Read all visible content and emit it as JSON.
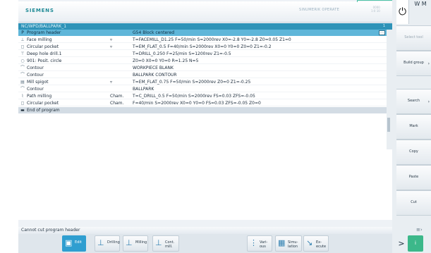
{
  "header": {
    "brand": "SIEMENS",
    "title_right": "SINUMERIK OPERATE",
    "mini_text": [
      "0000",
      "1:0 10"
    ]
  },
  "path_bar": {
    "path": "NC/WPD/BALLPARK_1",
    "number": "1"
  },
  "program": {
    "rows": [
      {
        "icon": "program-header-icon",
        "glyph": "P",
        "name": "Program header",
        "mode": "",
        "params": "G54 Block centered",
        "state": "selected"
      },
      {
        "icon": "face-milling-icon",
        "glyph": "⊥",
        "name": "Face milling",
        "mode": "▿",
        "params": "T=FACEMILL_D1.25 F=50/min S=2000rev X0=-2.8 Y0=-2.8 Z0=0.05 Z1=0",
        "state": ""
      },
      {
        "icon": "circular-pocket-icon",
        "glyph": "◻",
        "name": "Circular pocket",
        "mode": "▿",
        "params": "T=EM_FLAT_0.5 F=40/min S=2000rev X0=0 Y0=0 Z0=0 Z1=-0.2",
        "state": ""
      },
      {
        "icon": "deep-hole-drill-icon",
        "glyph": "⊤",
        "name": "Deep hole drill.1",
        "mode": "",
        "params": "T=DRILL_0.250 F=25/min S=1200rev Z1=-0.5",
        "state": ""
      },
      {
        "icon": "posit-circle-icon",
        "glyph": "○",
        "name": "901: Posit. circle",
        "mode": "",
        "params": "Z0=0 X0=0 Y0=0 R=1.25 N=5",
        "state": ""
      },
      {
        "icon": "contour-icon",
        "glyph": "⌒",
        "name": "Contour",
        "mode": "",
        "params": "WORKPIECE BLANK",
        "state": ""
      },
      {
        "icon": "contour-icon",
        "glyph": "⌒",
        "name": "Contour",
        "mode": "",
        "params": "BALLPARK CONTOUR",
        "state": ""
      },
      {
        "icon": "mill-spigot-icon",
        "glyph": "▤",
        "name": "Mill spigot",
        "mode": "▿",
        "params": "T=EM_FLAT_0.75 F=50/min S=2000rev Z0=0 Z1=-0.25",
        "state": ""
      },
      {
        "icon": "contour-icon",
        "glyph": "⌒",
        "name": "Contour",
        "mode": "",
        "params": "BALLPARK",
        "state": ""
      },
      {
        "icon": "path-milling-icon",
        "glyph": "⌇",
        "name": "Path milling",
        "mode": "Cham.",
        "params": "T=C_DRILL_0.5 F=50/min S=2000rev FS=0.03 ZFS=-0.05",
        "state": ""
      },
      {
        "icon": "circular-pocket-icon",
        "glyph": "◻",
        "name": "Circular pocket",
        "mode": "Cham.",
        "params": "F=40/min S=2000rev X0=0 Y0=0 FS=0.03 ZFS=-0.05 Z0=0",
        "state": ""
      },
      {
        "icon": "end-of-program-icon",
        "glyph": "▬",
        "name": "End of program",
        "mode": "",
        "params": "",
        "state": "end"
      }
    ],
    "more_button": "…"
  },
  "status": {
    "message": "Cannot cut program header"
  },
  "bottom_softkeys": [
    {
      "label": "Edit",
      "glyph": "▣",
      "icon": "edit-icon",
      "active": true
    },
    {
      "label": "Drilling",
      "glyph": "⊥",
      "icon": "drilling-icon",
      "active": false
    },
    {
      "label": "Milling",
      "glyph": "⊥",
      "icon": "milling-icon",
      "active": false
    },
    {
      "label": "Cont. mill.",
      "glyph": "⊥",
      "icon": "contour-milling-icon",
      "active": false
    },
    {
      "label": "Vari- ous",
      "glyph": "⋮",
      "icon": "various-icon",
      "active": false
    },
    {
      "label": "Simu- lation",
      "glyph": "▦",
      "icon": "simulation-icon",
      "active": false
    },
    {
      "label": "Ex- ecute",
      "glyph": "↘",
      "icon": "execute-icon",
      "active": false
    }
  ],
  "right_softkeys": [
    {
      "label": "Select tool",
      "dim": true
    },
    {
      "label": "Build group",
      "dim": false,
      "arrow": "›"
    },
    {
      "label": "Search",
      "dim": false,
      "arrow": "›"
    },
    {
      "label": "Mark",
      "dim": false
    },
    {
      "label": "Copy",
      "dim": false
    },
    {
      "label": "Paste",
      "dim": false
    },
    {
      "label": "Cut",
      "dim": false
    }
  ],
  "nav": {
    "next": ">",
    "mode_label": "i",
    "top_icon_text": "W M"
  }
}
